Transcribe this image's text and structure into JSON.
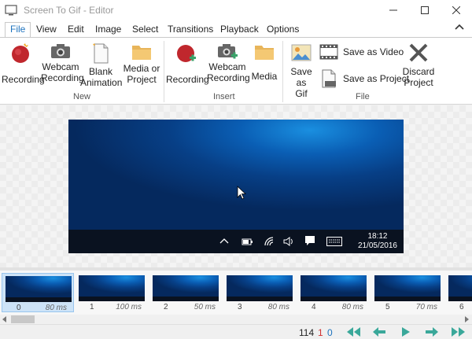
{
  "window": {
    "title": "Screen To Gif - Editor"
  },
  "tabs": [
    {
      "label": "File"
    },
    {
      "label": "View"
    },
    {
      "label": "Edit"
    },
    {
      "label": "Image"
    },
    {
      "label": "Select"
    },
    {
      "label": "Transitions"
    },
    {
      "label": "Playback"
    },
    {
      "label": "Options"
    }
  ],
  "ribbon": {
    "new_group": {
      "label": "New",
      "recording": "Recording",
      "webcam_1": "Webcam",
      "webcam_2": "Recording",
      "blank_1": "Blank",
      "blank_2": "Animation",
      "media_1": "Media or",
      "media_2": "Project"
    },
    "insert_group": {
      "label": "Insert",
      "recording": "Recording",
      "webcam_1": "Webcam",
      "webcam_2": "Recording",
      "media": "Media"
    },
    "file_group": {
      "label": "File",
      "save_gif_1": "Save as",
      "save_gif_2": "Gif",
      "save_video": "Save as Video",
      "save_project": "Save as Project",
      "discard_1": "Discard",
      "discard_2": "Project"
    }
  },
  "preview": {
    "time": "18:12",
    "date": "21/05/2016"
  },
  "frames": [
    {
      "index": "0",
      "delay": "80 ms"
    },
    {
      "index": "1",
      "delay": "100 ms"
    },
    {
      "index": "2",
      "delay": "50 ms"
    },
    {
      "index": "3",
      "delay": "80 ms"
    },
    {
      "index": "4",
      "delay": "80 ms"
    },
    {
      "index": "5",
      "delay": "70 ms"
    },
    {
      "index": "6",
      "delay": ""
    }
  ],
  "status": {
    "total_frames": "114",
    "selected_count": "1",
    "current_frame": "0"
  },
  "colors": {
    "accent": "#1e73be",
    "selected_count": "#d03030",
    "current_frame": "#1e73be",
    "nav_arrow": "#3aa89a"
  }
}
